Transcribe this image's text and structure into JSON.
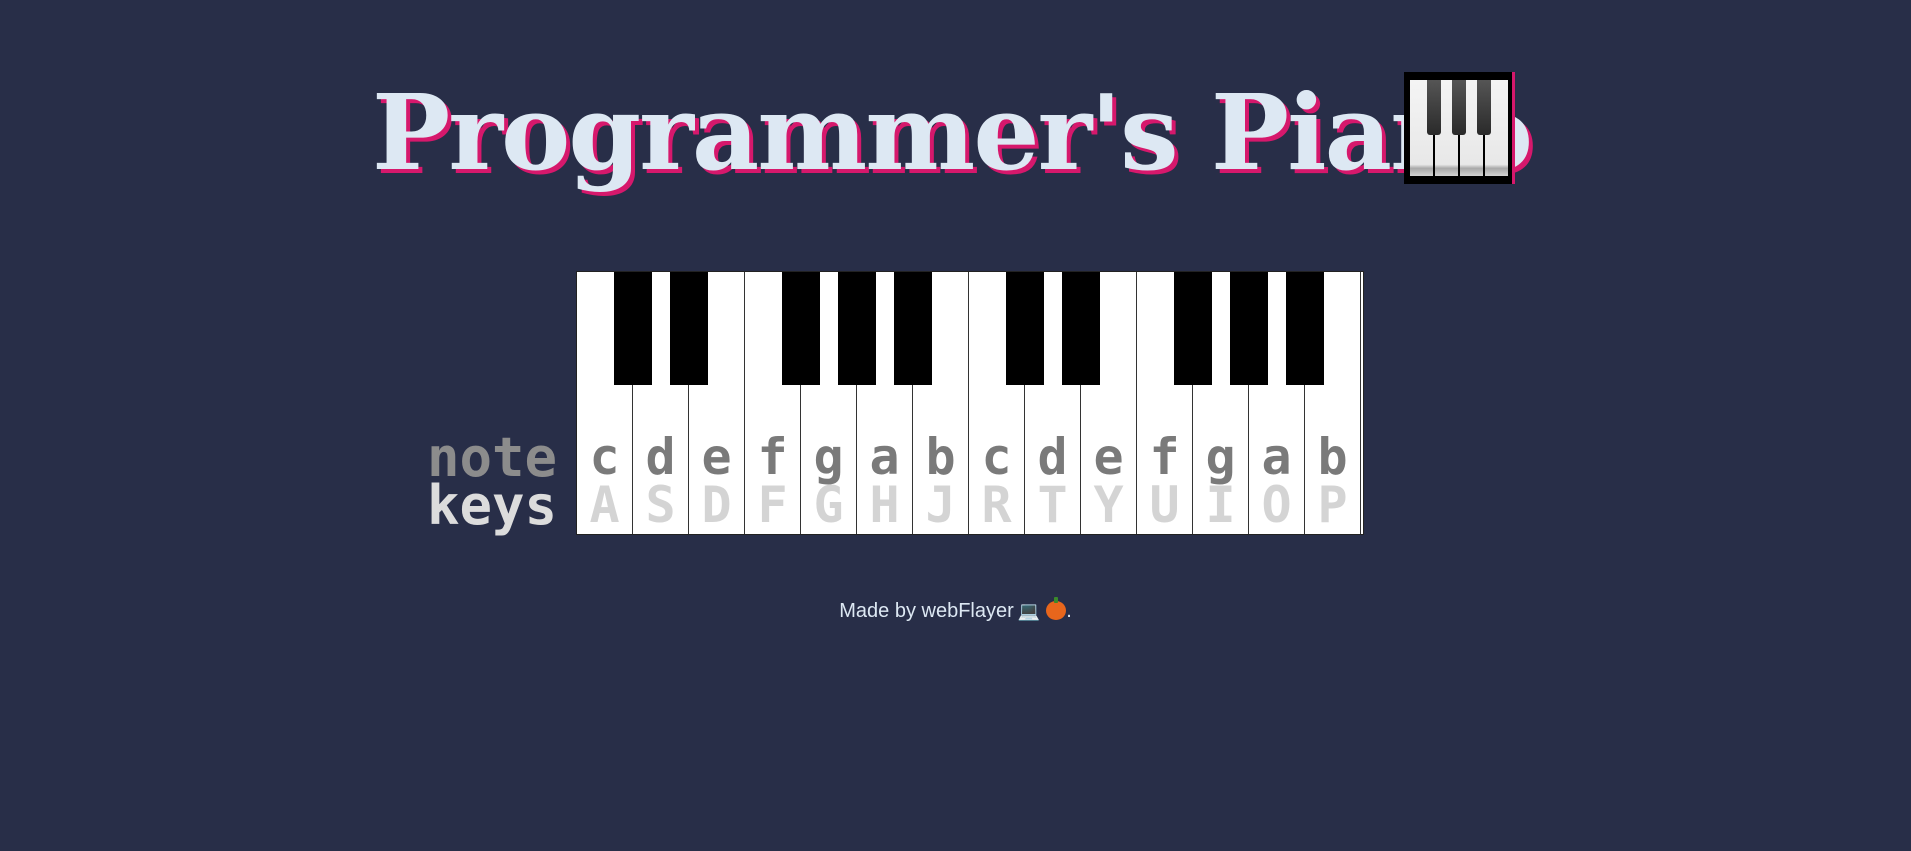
{
  "header": {
    "title": "Programmer's Piano",
    "title_icon": "piano-keys-icon"
  },
  "legend": {
    "note_label": "note",
    "keys_label": "keys"
  },
  "piano": {
    "white_keys": [
      {
        "note": "c",
        "key": "A"
      },
      {
        "note": "d",
        "key": "S"
      },
      {
        "note": "e",
        "key": "D"
      },
      {
        "note": "f",
        "key": "F"
      },
      {
        "note": "g",
        "key": "G"
      },
      {
        "note": "a",
        "key": "H"
      },
      {
        "note": "b",
        "key": "J"
      },
      {
        "note": "c",
        "key": "R"
      },
      {
        "note": "d",
        "key": "T"
      },
      {
        "note": "e",
        "key": "Y"
      },
      {
        "note": "f",
        "key": "U"
      },
      {
        "note": "g",
        "key": "I"
      },
      {
        "note": "a",
        "key": "O"
      },
      {
        "note": "b",
        "key": "P"
      }
    ],
    "black_key_count": 10
  },
  "footer": {
    "text": "Made by webFlayer",
    "suffix": ".",
    "icons": [
      "laptop-icon",
      "jack-o-lantern-icon"
    ]
  },
  "colors": {
    "background": "#282e48",
    "title_text": "#dde8f3",
    "title_shadow": "#d6186c",
    "note_text": "#7a7a7a",
    "key_text": "#d4d4d4"
  }
}
